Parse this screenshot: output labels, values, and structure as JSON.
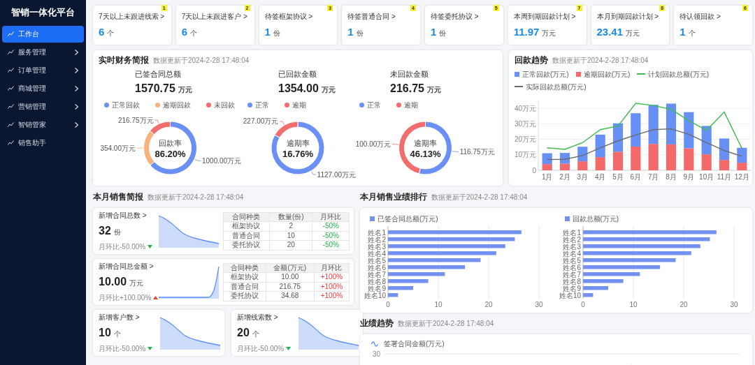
{
  "sidebar": {
    "title": "智销一体化平台",
    "items": [
      {
        "label": "工作台",
        "selected": true,
        "expandable": false
      },
      {
        "label": "服务管理",
        "selected": false,
        "expandable": true
      },
      {
        "label": "订单管理",
        "selected": false,
        "expandable": true
      },
      {
        "label": "商城管理",
        "selected": false,
        "expandable": true
      },
      {
        "label": "营销管理",
        "selected": false,
        "expandable": true
      },
      {
        "label": "智销管家",
        "selected": false,
        "expandable": true
      },
      {
        "label": "销售助手",
        "selected": false,
        "expandable": false
      }
    ]
  },
  "stat_cards": [
    {
      "label": "7天以上未跟进线索 >",
      "value": "6",
      "unit": "个",
      "badge": "1"
    },
    {
      "label": "7天以上未跟进客户 >",
      "value": "6",
      "unit": "个",
      "badge": "2"
    },
    {
      "label": "待签框架协议 >",
      "value": "1",
      "unit": "份",
      "badge": "3"
    },
    {
      "label": "待签普通合同 >",
      "value": "1",
      "unit": "份",
      "badge": "4"
    },
    {
      "label": "待签委托协议 >",
      "value": "1",
      "unit": "份",
      "badge": "5"
    },
    {
      "label": "本周到期回款计划 >",
      "value": "11.97",
      "unit": "万元",
      "badge": "7"
    },
    {
      "label": "本月到期回款计划 >",
      "value": "23.41",
      "unit": "万元",
      "badge": "8"
    },
    {
      "label": "待认领回款 >",
      "value": "1",
      "unit": "个",
      "badge": "6"
    }
  ],
  "finance": {
    "title": "实时财务简报",
    "updated": "数据更新于2024-2-28 17:48:04",
    "panels": [
      {
        "label": "已签合同总额",
        "value": "1570.75",
        "unit": "万元",
        "chart_data": {
          "type": "donut",
          "categories": [
            "正常回款",
            "逾期回款",
            "未回款"
          ],
          "values": [
            1000,
            354,
            216.75
          ],
          "colors": [
            "#6a8ff5",
            "#f9b27d",
            "#f26d6d"
          ],
          "value_labels": [
            "1000.00万元",
            "354.00万元",
            "216.75万元"
          ],
          "annotations": [
            "回款率",
            "86.20%"
          ]
        }
      },
      {
        "label": "已回款金额",
        "value": "1354.00",
        "unit": "万元",
        "chart_data": {
          "type": "donut",
          "categories": [
            "正常",
            "逾期"
          ],
          "values": [
            1127,
            227
          ],
          "colors": [
            "#6a8ff5",
            "#f26d6d"
          ],
          "value_labels": [
            "1127.00万元",
            "227.00万元"
          ],
          "annotations": [
            "逾期率",
            "16.76%"
          ]
        }
      },
      {
        "label": "未回款金额",
        "value": "216.75",
        "unit": "万元",
        "chart_data": {
          "type": "donut",
          "categories": [
            "正常",
            "逾期"
          ],
          "values": [
            116.75,
            100
          ],
          "colors": [
            "#6a8ff5",
            "#f26d6d"
          ],
          "value_labels": [
            "116.75万元",
            "100.00万元"
          ],
          "annotations": [
            "逾期率",
            "46.13%"
          ]
        }
      }
    ]
  },
  "payment_trend": {
    "title": "回款趋势",
    "updated": "数据更新于2024-2-28 17:48:04",
    "chart_data": {
      "type": "bar",
      "stacked": true,
      "categories": [
        "1月",
        "2月",
        "3月",
        "4月",
        "5月",
        "6月",
        "7月",
        "8月",
        "9月",
        "10月",
        "11月",
        "12月"
      ],
      "grid": true,
      "ylim": [
        0,
        45
      ],
      "yticks": [
        0,
        {
          "value": 10,
          "label": "10万元"
        },
        {
          "value": 20,
          "label": "20万元"
        },
        {
          "value": 30,
          "label": "30万元"
        },
        {
          "value": 40,
          "label": "40万元"
        }
      ],
      "series": [
        {
          "name": "逾期回款(万元)",
          "type": "bar",
          "color": "#f46a6a",
          "values": [
            4,
            4.3,
            5.8,
            8.5,
            12,
            15.3,
            17,
            16.7,
            14.2,
            10.3,
            6.7,
            4.9
          ]
        },
        {
          "name": "正常回款(万元)",
          "type": "bar",
          "color": "#6690f5",
          "values": [
            7,
            6.9,
            9.4,
            14.5,
            18.3,
            21.5,
            25.2,
            26.3,
            23.3,
            18.3,
            13.8,
            9.6
          ]
        },
        {
          "name": "计划回款总额(万元)",
          "type": "line",
          "color": "#3dbb4c",
          "values": [
            14.5,
            13.5,
            17.8,
            26.2,
            28.5,
            43.2,
            41.8,
            39.3,
            32,
            25.8,
            37.6,
            14
          ]
        },
        {
          "name": "实际回款总额(万元)",
          "type": "line",
          "color": "#6b6b6b",
          "values": [
            7,
            7.1,
            9.5,
            14.5,
            19,
            22.8,
            26.2,
            26.7,
            23.2,
            17.8,
            12.8,
            9
          ]
        }
      ]
    }
  },
  "sales_brief": {
    "title": "本月销售简报",
    "updated": "数据更新于2024-2-28 17:48:04",
    "cards": [
      {
        "title": "新增合同总数 >",
        "value": "32",
        "unit": "份",
        "change": "月环比-50.00%",
        "rising": false,
        "table": {
          "columns": [
            "合同种类",
            "数量(份)",
            "月环比"
          ],
          "rows": [
            [
              "框架协议",
              "2",
              "-50%"
            ],
            [
              "普通合同",
              "10",
              "-50%"
            ],
            [
              "委托协议",
              "20",
              "-50%"
            ]
          ]
        }
      },
      {
        "title": "新增合同总金额 >",
        "value": "10.00",
        "unit": "万元",
        "change": "月环比+100.00%",
        "rising": true,
        "table": {
          "columns": [
            "合同种类",
            "金额(万元)",
            "月环比"
          ],
          "rows": [
            [
              "框架协议",
              "10.00",
              "+100%"
            ],
            [
              "普通合同",
              "216.75",
              "+100%"
            ],
            [
              "委托协议",
              "34.68",
              "+100%"
            ]
          ]
        }
      },
      {
        "title": "新增客户数 >",
        "value": "10",
        "unit": "个",
        "change": "月环比-50.00%",
        "rising": false
      },
      {
        "title": "新增线索数 >",
        "value": "20",
        "unit": "个",
        "change": "月环比-50.00%",
        "rising": false
      }
    ]
  },
  "ranking": {
    "title": "本月销售业绩排行",
    "updated": "数据更新于2024-2-28 17:48:04",
    "charts": [
      {
        "chart_data": {
          "type": "bar",
          "orientation": "horizontal",
          "categories": [
            "姓名1",
            "姓名2",
            "姓名3",
            "姓名4",
            "姓名5",
            "姓名6",
            "姓名7",
            "姓名8",
            "姓名9",
            "姓名10"
          ],
          "xlim": [
            0,
            30
          ],
          "xticks": [
            0,
            10,
            20,
            30
          ],
          "series": [
            {
              "name": "已签合同总额(万元)",
              "color": "#7392f0",
              "values": [
                26.5,
                25.2,
                23.3,
                21.5,
                18.4,
                15.3,
                11.3,
                8,
                5,
                2
              ]
            }
          ]
        }
      },
      {
        "chart_data": {
          "type": "bar",
          "orientation": "horizontal",
          "categories": [
            "姓名1",
            "姓名2",
            "姓名3",
            "姓名4",
            "姓名5",
            "姓名6",
            "姓名7",
            "姓名8",
            "姓名9",
            "姓名10"
          ],
          "xlim": [
            0,
            30
          ],
          "xticks": [
            0,
            10,
            20,
            30
          ],
          "series": [
            {
              "name": "回款总额(万元)",
              "color": "#7392f0",
              "values": [
                26.5,
                25.2,
                23.3,
                21.5,
                18.4,
                15.3,
                11.3,
                8,
                5,
                2
              ]
            }
          ]
        }
      }
    ]
  },
  "performance": {
    "title": "业绩趋势",
    "updated": "数据更新于2024-2-28 17:48:04",
    "legend": "签署合同金额(万元)",
    "ytick": "30"
  }
}
